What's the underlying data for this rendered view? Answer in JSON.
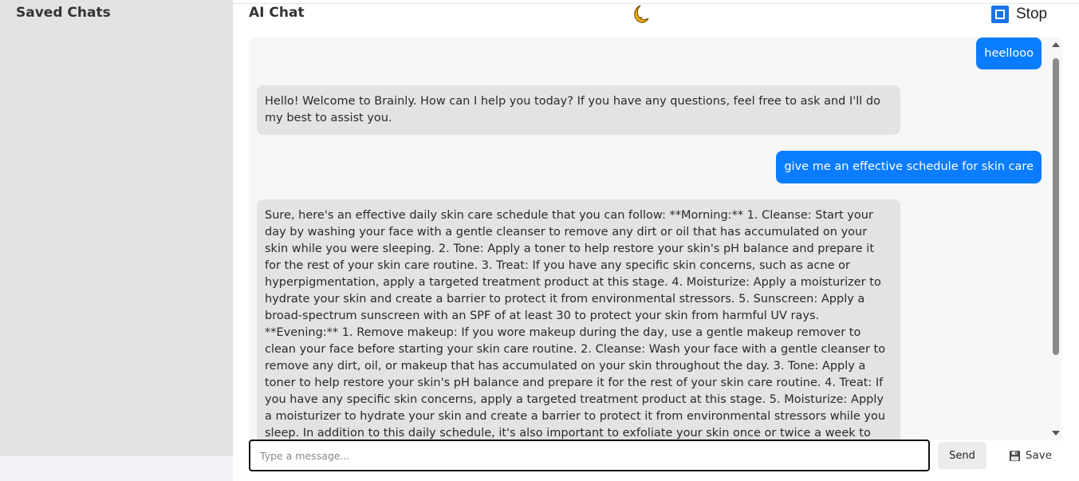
{
  "sidebar": {
    "title": "Saved Chats"
  },
  "header": {
    "title": "AI Chat",
    "theme_icon": "moon-icon",
    "stop_label": "Stop",
    "stop_icon": "stop-icon"
  },
  "messages": [
    {
      "role": "user",
      "text": "heellooo"
    },
    {
      "role": "bot",
      "text": "Hello! Welcome to Brainly. How can I help you today? If you have any questions, feel free to ask and I'll do my best to assist you."
    },
    {
      "role": "user",
      "text": "give me an effective schedule for skin care"
    },
    {
      "role": "bot",
      "text": "Sure, here's an effective daily skin care schedule that you can follow: **Morning:** 1. Cleanse: Start your day by washing your face with a gentle cleanser to remove any dirt or oil that has accumulated on your skin while you were sleeping. 2. Tone: Apply a toner to help restore your skin's pH balance and prepare it for the rest of your skin care routine. 3. Treat: If you have any specific skin concerns, such as acne or hyperpigmentation, apply a targeted treatment product at this stage. 4. Moisturize: Apply a moisturizer to hydrate your skin and create a barrier to protect it from environmental stressors. 5. Sunscreen: Apply a broad-spectrum sunscreen with an SPF of at least 30 to protect your skin from harmful UV rays. **Evening:** 1. Remove makeup: If you wore makeup during the day, use a gentle makeup remover to clean your face before starting your skin care routine. 2. Cleanse: Wash your face with a gentle cleanser to remove any dirt, oil, or makeup that has accumulated on your skin throughout the day. 3. Tone: Apply a toner to help restore your skin's pH balance and prepare it for the rest of your skin care routine. 4. Treat: If you have any specific skin concerns, apply a targeted treatment product at this stage. 5. Moisturize: Apply a moisturizer to hydrate your skin and create a barrier to protect it from environmental stressors while you sleep. In addition to this daily schedule, it's also important to exfoliate your skin once or twice a week to remove dead skin cells and reveal brighter, smoother skin. You can use a"
    }
  ],
  "composer": {
    "placeholder": "Type a message...",
    "send_label": "Send",
    "save_label": "Save",
    "save_icon": "floppy-disk-icon"
  },
  "colors": {
    "user_bubble": "#0a7cff",
    "bot_bubble": "#e3e3e3",
    "sidebar_bg": "#e3e3e3",
    "stop_accent": "#1a73e8"
  }
}
